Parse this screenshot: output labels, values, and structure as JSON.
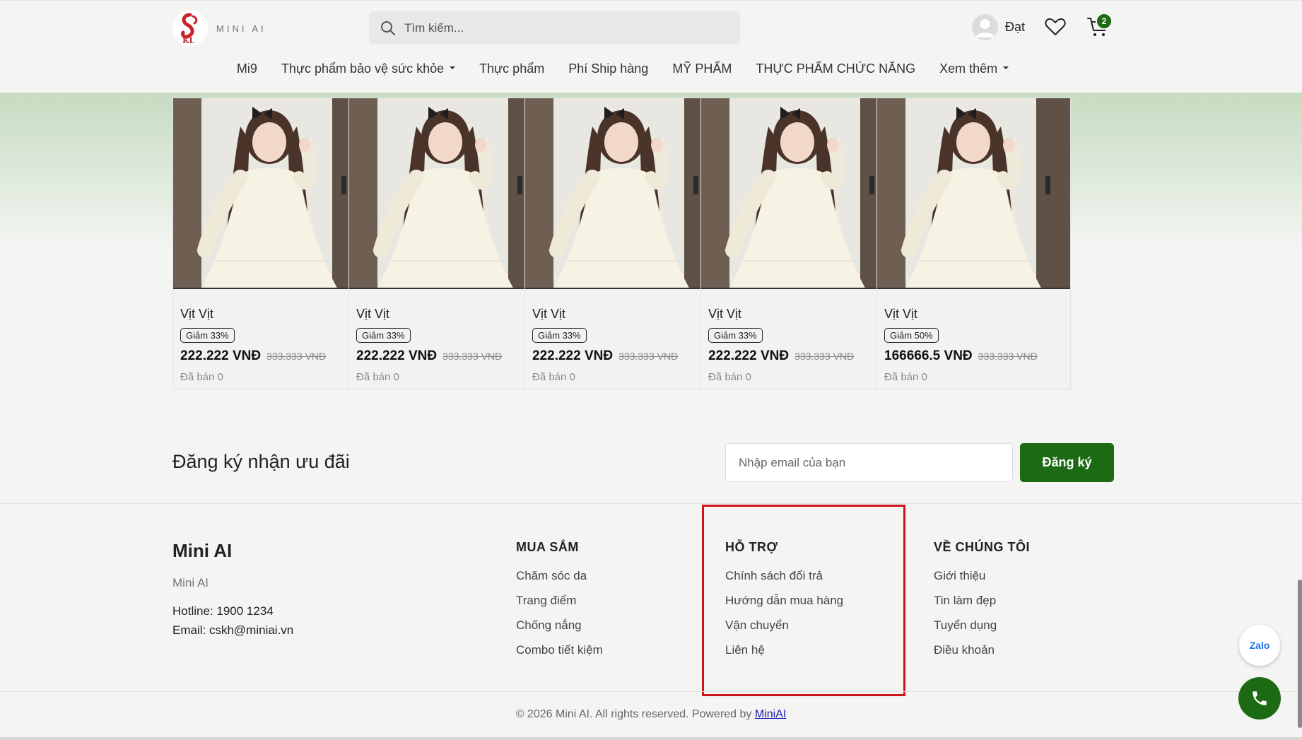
{
  "header": {
    "logo_text": "MINI AI",
    "search_placeholder": "Tìm kiếm...",
    "user_name": "Đạt",
    "cart_count": "2"
  },
  "nav": {
    "items": [
      {
        "label": "Mi9",
        "dropdown": false
      },
      {
        "label": "Thực phẩm bảo vệ sức khỏe",
        "dropdown": true
      },
      {
        "label": "Thực phẩm",
        "dropdown": false
      },
      {
        "label": "Phí Ship hàng",
        "dropdown": false
      },
      {
        "label": "MỸ PHẨM",
        "dropdown": false
      },
      {
        "label": "THỰC PHẨM CHỨC NĂNG",
        "dropdown": false
      },
      {
        "label": "Xem thêm",
        "dropdown": true
      }
    ]
  },
  "products": [
    {
      "name": "Vịt Vịt",
      "discount": "Giảm 33%",
      "price": "222.222 VNĐ",
      "old_price": "333.333 VNĐ",
      "sold": "Đã bán 0"
    },
    {
      "name": "Vịt Vịt",
      "discount": "Giảm 33%",
      "price": "222.222 VNĐ",
      "old_price": "333.333 VNĐ",
      "sold": "Đã bán 0"
    },
    {
      "name": "Vịt Vịt",
      "discount": "Giảm 33%",
      "price": "222.222 VNĐ",
      "old_price": "333.333 VNĐ",
      "sold": "Đã bán 0"
    },
    {
      "name": "Vịt Vịt",
      "discount": "Giảm 33%",
      "price": "222.222 VNĐ",
      "old_price": "333.333 VNĐ",
      "sold": "Đã bán 0"
    },
    {
      "name": "Vịt Vịt",
      "discount": "Giảm 50%",
      "price": "166666.5 VNĐ",
      "old_price": "333.333 VNĐ",
      "sold": "Đã bán 0"
    }
  ],
  "newsletter": {
    "title": "Đăng ký nhận ưu đãi",
    "placeholder": "Nhập email của bạn",
    "button": "Đăng ký"
  },
  "footer": {
    "brand": {
      "title": "Mini AI",
      "subtitle": "Mini AI",
      "hotline_label": "Hotline: ",
      "hotline": "1900 1234",
      "email_label": "Email: ",
      "email": "cskh@miniai.vn"
    },
    "columns": [
      {
        "title": "MUA SẮM",
        "links": [
          "Chăm sóc da",
          "Trang điểm",
          "Chống nắng",
          "Combo tiết kiệm"
        ]
      },
      {
        "title": "HỖ TRỢ",
        "links": [
          "Chính sách đổi trả",
          "Hướng dẫn mua hàng",
          "Vận chuyển",
          "Liên hệ"
        ]
      },
      {
        "title": "VỀ CHÚNG TÔI",
        "links": [
          "Giới thiệu",
          "Tin làm đẹp",
          "Tuyển dụng",
          "Điều khoản"
        ]
      }
    ],
    "copyright": "© 2026 Mini AI. All rights reserved. Powered by ",
    "powered_link": "MiniAI"
  },
  "floating": {
    "zalo_label": "Zalo"
  },
  "colors": {
    "brand_green": "#1c6b14",
    "highlight_red": "#d0141c",
    "logo_red": "#c8232c"
  },
  "icons": [
    "logo-icon",
    "search-icon",
    "user-avatar-icon",
    "heart-icon",
    "cart-icon",
    "phone-icon",
    "zalo-icon"
  ]
}
